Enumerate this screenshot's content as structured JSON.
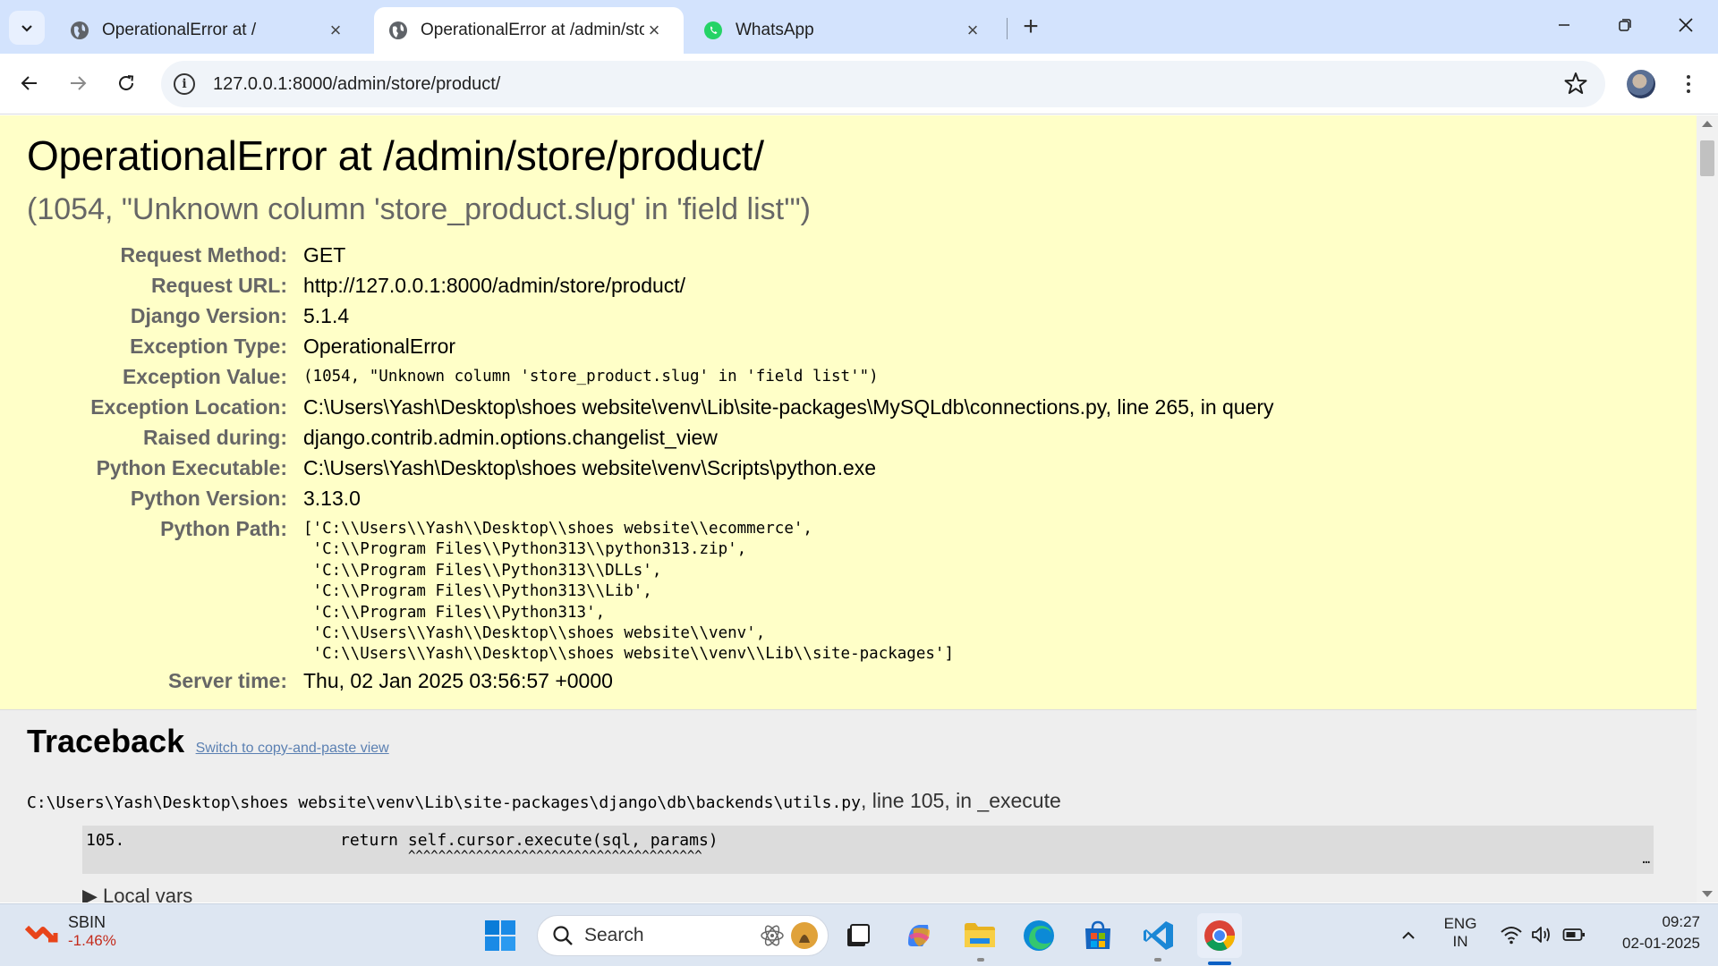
{
  "browser": {
    "tabs": [
      {
        "title": "OperationalError at /",
        "active": false
      },
      {
        "title": "OperationalError at /admin/store/product/",
        "active": true
      },
      {
        "title": "WhatsApp",
        "active": false
      }
    ],
    "url": "127.0.0.1:8000/admin/store/product/"
  },
  "error": {
    "title": "OperationalError at /admin/store/product/",
    "subtitle": "(1054, \"Unknown column 'store_product.slug' in 'field list'\")",
    "meta": [
      {
        "label": "Request Method:",
        "value": "GET"
      },
      {
        "label": "Request URL:",
        "value": "http://127.0.0.1:8000/admin/store/product/"
      },
      {
        "label": "Django Version:",
        "value": "5.1.4"
      },
      {
        "label": "Exception Type:",
        "value": "OperationalError"
      },
      {
        "label": "Exception Value:",
        "value": "(1054, \"Unknown column 'store_product.slug' in 'field list'\")"
      },
      {
        "label": "Exception Location:",
        "value": "C:\\Users\\Yash\\Desktop\\shoes website\\venv\\Lib\\site-packages\\MySQLdb\\connections.py, line 265, in query"
      },
      {
        "label": "Raised during:",
        "value": "django.contrib.admin.options.changelist_view"
      },
      {
        "label": "Python Executable:",
        "value": "C:\\Users\\Yash\\Desktop\\shoes website\\venv\\Scripts\\python.exe"
      },
      {
        "label": "Python Version:",
        "value": "3.13.0"
      }
    ],
    "python_path_label": "Python Path:",
    "python_path": "['C:\\\\Users\\\\Yash\\\\Desktop\\\\shoes website\\\\ecommerce',\n 'C:\\\\Program Files\\\\Python313\\\\python313.zip',\n 'C:\\\\Program Files\\\\Python313\\\\DLLs',\n 'C:\\\\Program Files\\\\Python313\\\\Lib',\n 'C:\\\\Program Files\\\\Python313',\n 'C:\\\\Users\\\\Yash\\\\Desktop\\\\shoes website\\\\venv',\n 'C:\\\\Users\\\\Yash\\\\Desktop\\\\shoes website\\\\venv\\\\Lib\\\\site-packages']",
    "server_time_label": "Server time:",
    "server_time": "Thu, 02 Jan 2025 03:56:57 +0000"
  },
  "traceback": {
    "heading": "Traceback",
    "switch_link": "Switch to copy-and-paste view",
    "frame_path": "C:\\Users\\Yash\\Desktop\\shoes website\\venv\\Lib\\site-packages\\django\\db\\backends\\utils.py",
    "frame_location": ", line 105, in _execute",
    "line_no": "105.",
    "source": "return self.cursor.execute(sql, params)",
    "carets": "^^^^^^^^^^^^^^^^^^^^^^^^^^^^^^^^^^^^^^^",
    "ellipsis": "…",
    "local_vars": "▶ Local vars"
  },
  "taskbar": {
    "stock_name": "SBIN",
    "stock_change": "-1.46%",
    "search_label": "Search",
    "lang_top": "ENG",
    "lang_bottom": "IN",
    "time": "09:27",
    "date": "02-01-2025"
  },
  "colors": {
    "summary_bg": "#ffffc8",
    "tab_strip": "#d3e3fd",
    "stock_negative": "#c42b1c"
  }
}
